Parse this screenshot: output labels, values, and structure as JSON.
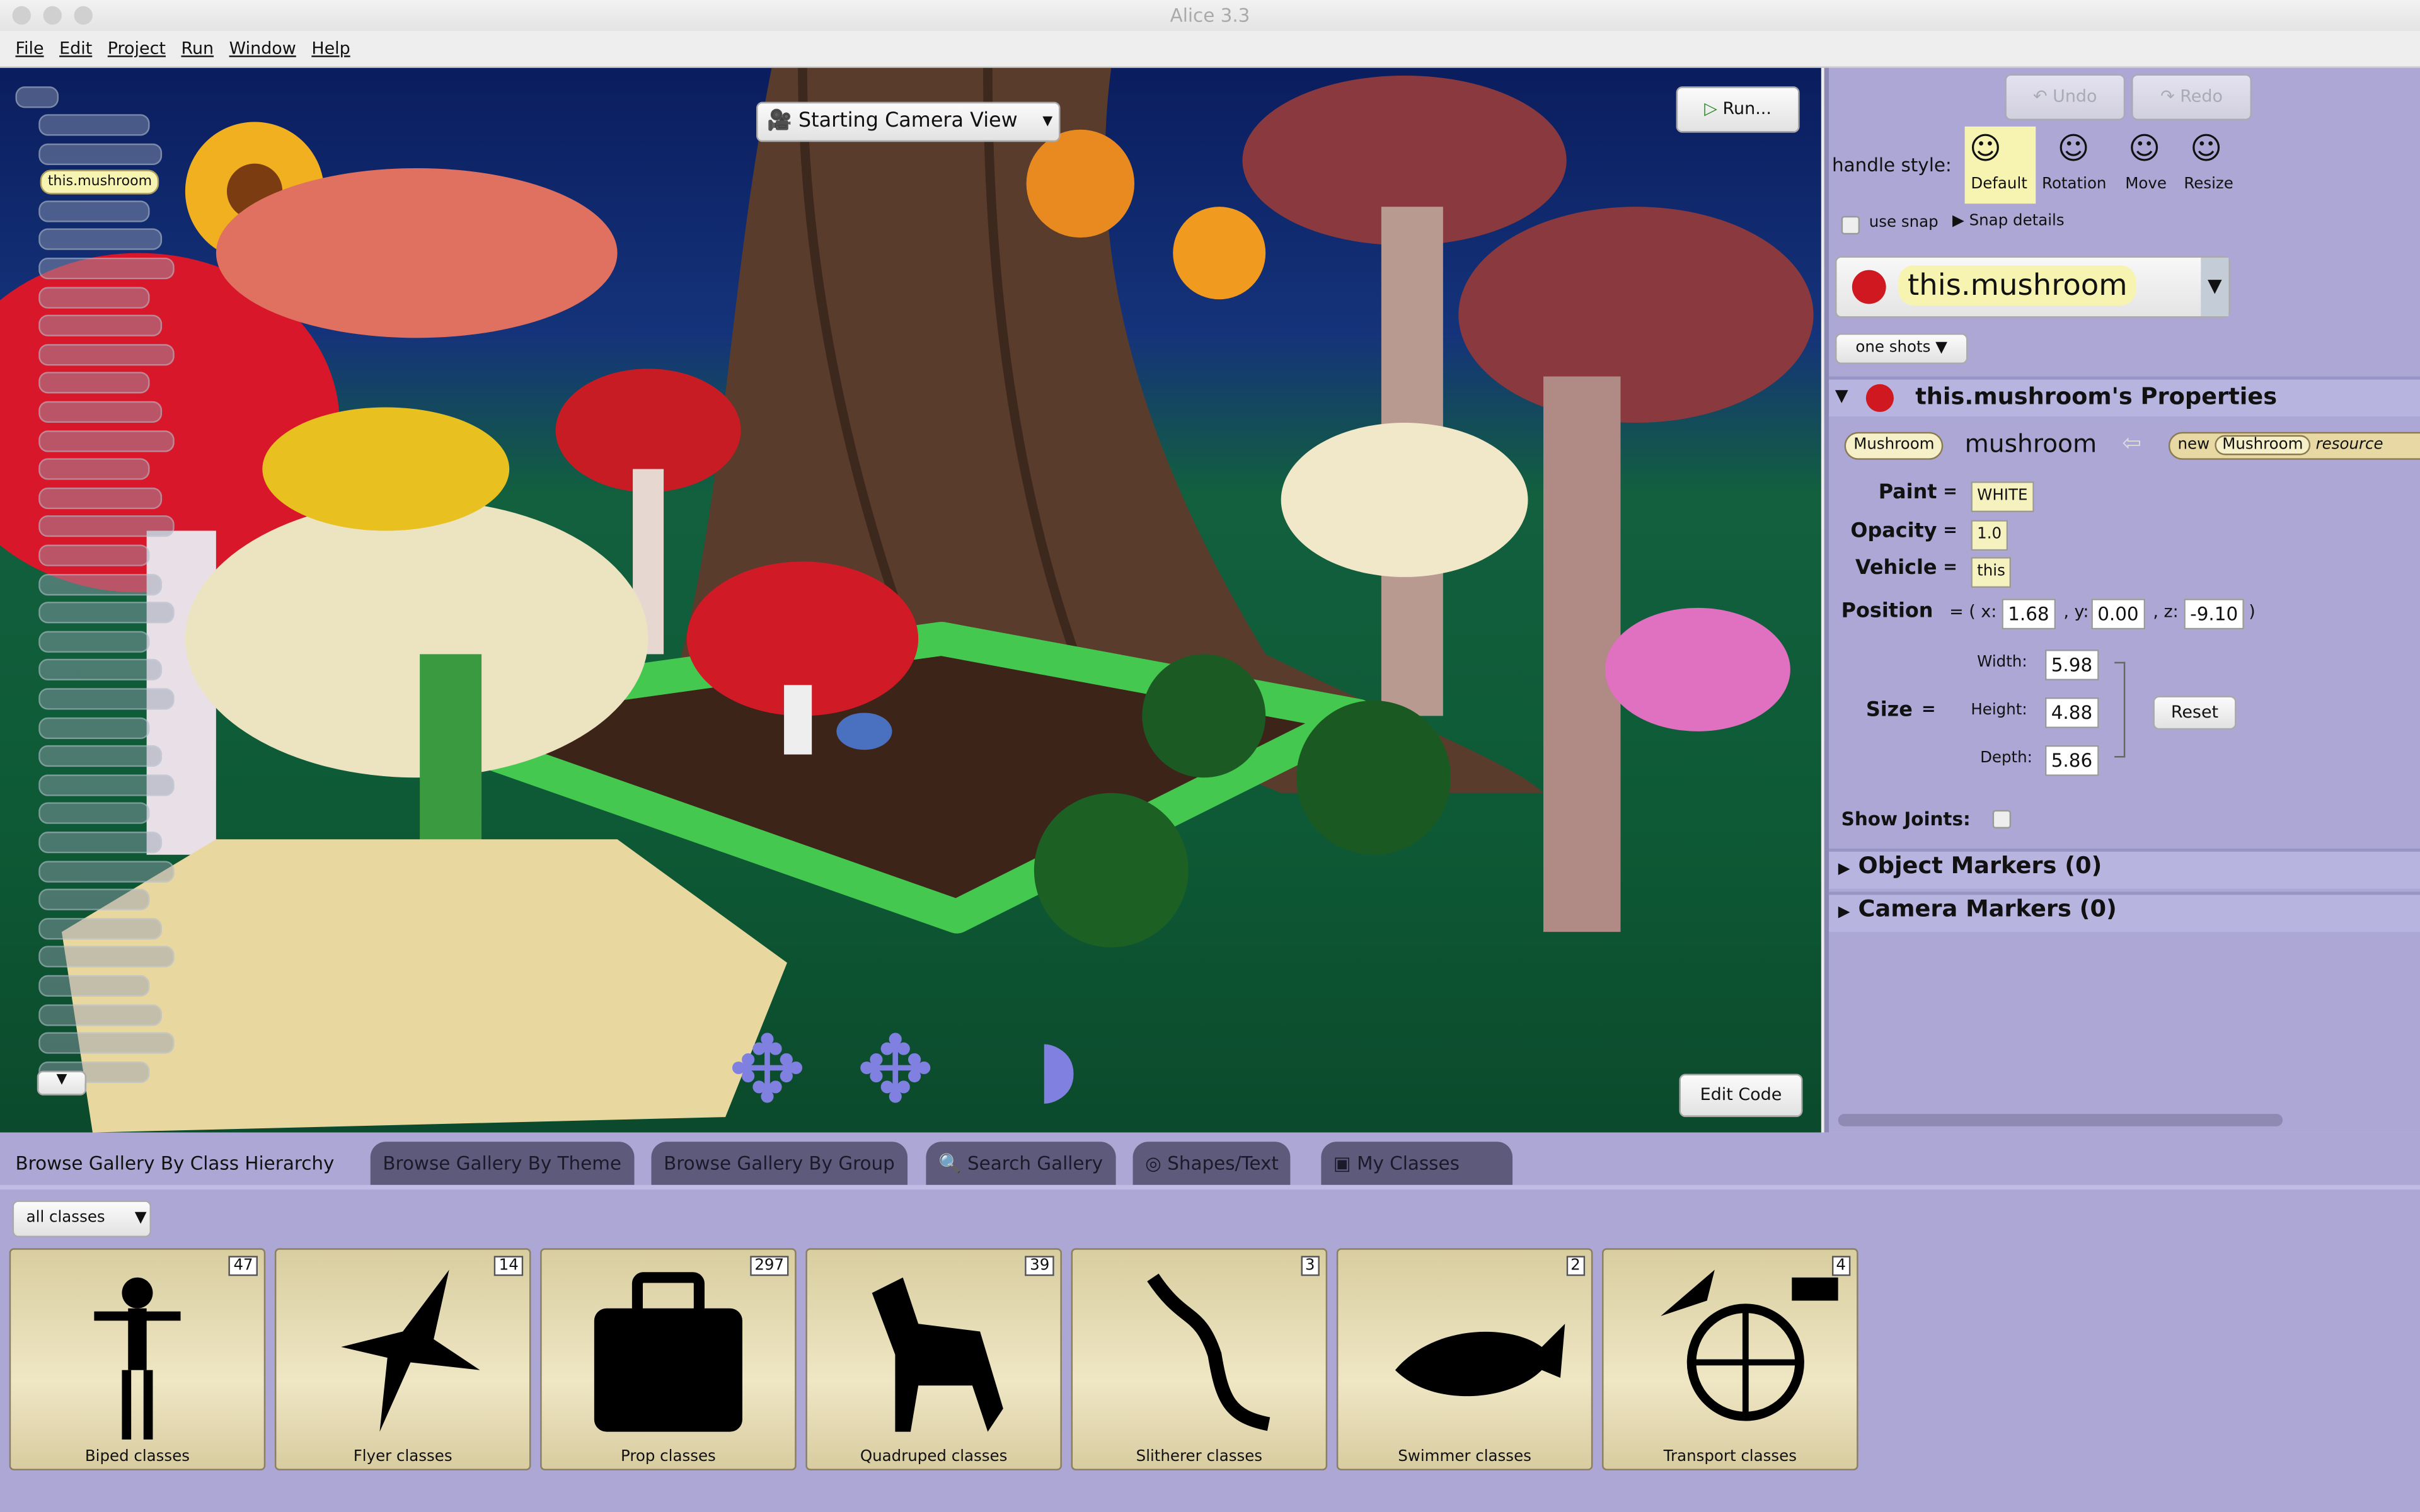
{
  "window": {
    "title": "Alice 3.3"
  },
  "menu": [
    "File",
    "Edit",
    "Project",
    "Run",
    "Window",
    "Help"
  ],
  "scene": {
    "camera_view": "Starting Camera View",
    "run_label": "Run...",
    "edit_code_label": "Edit Code",
    "selected_tree_item": "this.mushroom"
  },
  "toolbar": {
    "undo": "Undo",
    "redo": "Redo"
  },
  "handle": {
    "label": "handle style:",
    "styles": [
      "Default",
      "Rotation",
      "Move",
      "Resize"
    ],
    "selected": "Default",
    "use_snap": "use snap",
    "snap_details": "Snap details"
  },
  "selector": {
    "value": "this.mushroom",
    "one_shots": "one shots"
  },
  "properties": {
    "header": "this.mushroom's Properties",
    "type": "Mushroom",
    "name": "mushroom",
    "new": "new",
    "ctor_type": "Mushroom",
    "resource": "resource",
    "paint_label": "Paint",
    "paint": "WHITE",
    "opacity_label": "Opacity",
    "opacity": "1.0",
    "vehicle_label": "Vehicle",
    "vehicle": "this",
    "position_label": "Position",
    "x": "1.68",
    "y": "0.00",
    "z": "-9.10",
    "size_label": "Size",
    "width_label": "Width:",
    "width": "5.98",
    "height_label": "Height:",
    "height": "4.88",
    "depth_label": "Depth:",
    "depth": "5.86",
    "reset": "Reset",
    "show_joints": "Show Joints:"
  },
  "sections": [
    "Object Markers (0)",
    "Camera Markers (0)"
  ],
  "gallery": {
    "tabs": [
      "Browse Gallery By Class Hierarchy",
      "Browse Gallery By Theme",
      "Browse Gallery By Group",
      "Search Gallery",
      "Shapes/Text",
      "My Classes"
    ],
    "filter": "all classes",
    "tiles": [
      {
        "label": "Biped classes",
        "count": "47"
      },
      {
        "label": "Flyer classes",
        "count": "14"
      },
      {
        "label": "Prop classes",
        "count": "297"
      },
      {
        "label": "Quadruped classes",
        "count": "39"
      },
      {
        "label": "Slitherer classes",
        "count": "3"
      },
      {
        "label": "Swimmer classes",
        "count": "2"
      },
      {
        "label": "Transport classes",
        "count": "4"
      }
    ]
  },
  "colors": {
    "panel": "#aca7d5",
    "tab_inactive": "#5e5a7c",
    "tile": "#efe6c4",
    "selected_highlight": "#f7f3b0"
  }
}
